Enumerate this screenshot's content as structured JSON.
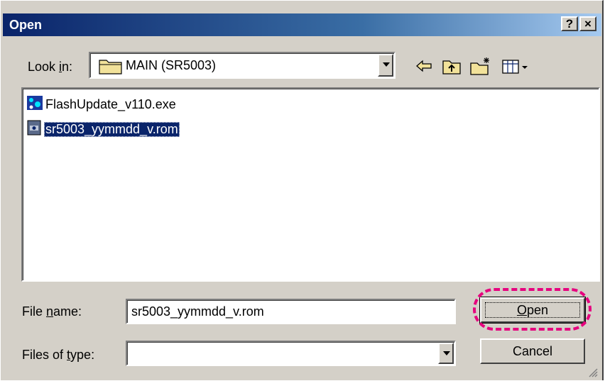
{
  "window": {
    "title": "Open",
    "help_label": "?",
    "close_label": "×"
  },
  "look_in": {
    "label_pre": "Look ",
    "label_accel": "i",
    "label_post": "n:",
    "value": "MAIN (SR5003)"
  },
  "files": [
    {
      "name": "FlashUpdate_v110.exe",
      "icon": "executable-icon",
      "selected": false
    },
    {
      "name": "sr5003_yymmdd_v.rom",
      "icon": "rom-file-icon",
      "selected": true
    }
  ],
  "file_name": {
    "label_pre": "File ",
    "label_accel": "n",
    "label_post": "ame:",
    "value": "sr5003_yymmdd_v.rom"
  },
  "file_type": {
    "label_pre": "Files of ",
    "label_accel": "t",
    "label_post": "ype:",
    "value": ""
  },
  "buttons": {
    "open_accel": "O",
    "open_rest": "pen",
    "cancel": "Cancel"
  },
  "colors": {
    "titlebar_start": "#0a246a",
    "titlebar_end": "#a6caf0",
    "selection": "#0a246a",
    "highlight_ring": "#e6007e",
    "face": "#d4d0c8"
  }
}
